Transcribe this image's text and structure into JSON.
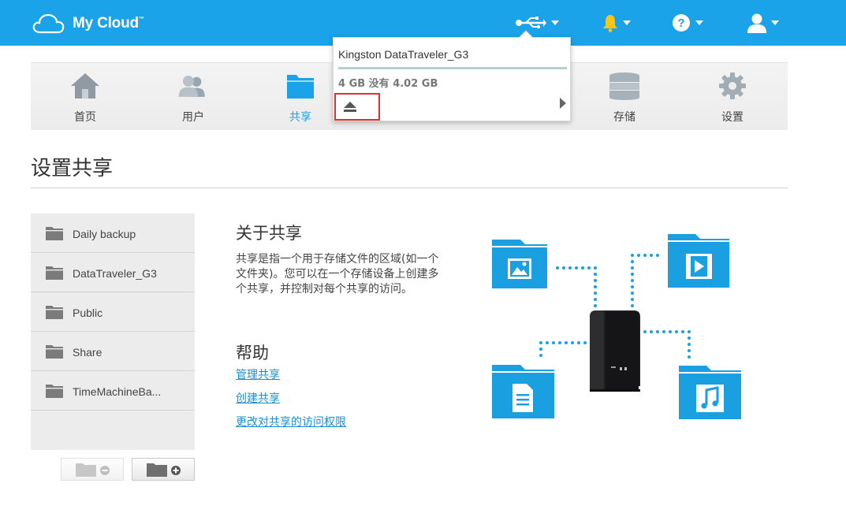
{
  "app": {
    "logo_text": "My Cloud",
    "logo_tm": "™"
  },
  "topbar": {
    "icons": [
      "usb-icon",
      "bell-icon",
      "help-icon",
      "user-icon"
    ],
    "brand_color": "#1aa3e8",
    "bell_color": "#f5c518"
  },
  "nav": {
    "items": [
      {
        "label": "首页",
        "icon": "home-icon"
      },
      {
        "label": "用户",
        "icon": "users-icon"
      },
      {
        "label": "共享",
        "icon": "share-folder-icon",
        "active": true
      },
      {
        "label": "存储",
        "icon": "storage-icon"
      },
      {
        "label": "设置",
        "icon": "gear-icon"
      }
    ]
  },
  "usb_popup": {
    "device_name": "Kingston DataTraveler_G3",
    "capacity_text": "4 GB 没有 4.02 GB",
    "used_fraction": 1.0,
    "eject_icon": "eject-icon",
    "next_icon": "chevron-right-icon"
  },
  "page": {
    "title": "设置共享"
  },
  "shares": {
    "items": [
      {
        "label": "Daily backup"
      },
      {
        "label": "DataTraveler_G3"
      },
      {
        "label": "Public"
      },
      {
        "label": "Share"
      },
      {
        "label": "TimeMachineBa..."
      }
    ],
    "remove_icon": "remove-folder-icon",
    "add_icon": "add-folder-icon"
  },
  "about": {
    "title": "关于共享",
    "body": "共享是指一个用于存储文件的区域(如一个文件夹)。您可以在一个存储设备上创建多个共享，并控制对每个共享的访问。"
  },
  "help": {
    "title": "帮助",
    "links": [
      "管理共享",
      "创建共享",
      "更改对共享的访问权限"
    ],
    "link_color": "#1a8fd1"
  },
  "illustration": {
    "folders": [
      "image-folder-icon",
      "video-folder-icon",
      "document-folder-icon",
      "music-folder-icon"
    ],
    "device": "nas-device-icon",
    "folder_color": "#1a9fe0"
  }
}
